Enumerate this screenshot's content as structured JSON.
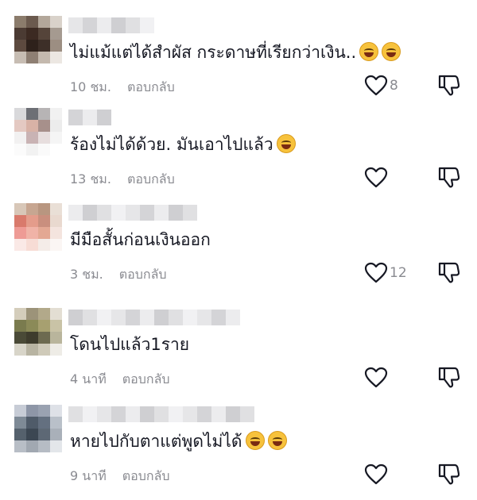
{
  "comments": [
    {
      "text": "ไม่แม้แต่ได้สำผัส กระดาษที่เรียกว่าเงิน..",
      "emojis": 2,
      "time": "10 ชม.",
      "reply": "ตอบกลับ",
      "likes": "8",
      "avatar": [
        "#8b7c6c",
        "#6b5a4e",
        "#b3a79a",
        "#d9d2ca",
        "#4b3b33",
        "#3c2a22",
        "#55443a",
        "#a59a90",
        "#5d4a3f",
        "#2e211b",
        "#3d2f28",
        "#9c8e82",
        "#c7bdb3",
        "#8e7f73",
        "#c4b9ae",
        "#ece7e2"
      ],
      "name_w": 6
    },
    {
      "text": "ร้องไม่ได้ด้วย. มันเอาไปแล้ว",
      "emojis": 1,
      "time": "13 ชม.",
      "reply": "ตอบกลับ",
      "likes": "",
      "avatar": [
        "#d9d9db",
        "#6d6f75",
        "#b7b4b5",
        "#f1f1f1",
        "#e4c9c2",
        "#d8b2a6",
        "#a7908b",
        "#ececec",
        "#f2f1f1",
        "#c9b3b4",
        "#e7dede",
        "#f5f5f5",
        "#fbfbfb",
        "#f2f2f2",
        "#fafafa",
        "#ffffff"
      ],
      "name_w": 3
    },
    {
      "text": "มีมือสั้นก่อนเงินออก",
      "emojis": 0,
      "time": "3 ชม.",
      "reply": "ตอบกลับ",
      "likes": "12",
      "avatar": [
        "#d8c7b8",
        "#c7a691",
        "#b89680",
        "#e9dfd6",
        "#d97a6c",
        "#e49c8b",
        "#c98f7e",
        "#e9d9cf",
        "#ee9b95",
        "#f0b3a7",
        "#e3a893",
        "#f4e4de",
        "#fae9e6",
        "#f7dcd5",
        "#f4ece8",
        "#fbf6f4"
      ],
      "name_w": 9
    },
    {
      "text": "โดนไปแล้ว1ราย",
      "emojis": 0,
      "time": "4 นาที",
      "reply": "ตอบกลับ",
      "likes": "",
      "avatar": [
        "#d4cdbb",
        "#9c9379",
        "#b2a98a",
        "#e3ded3",
        "#7a7b4e",
        "#8b8a58",
        "#a7a070",
        "#c9c3a6",
        "#4a4a37",
        "#3e3c2d",
        "#6d6a50",
        "#b9b59c",
        "#d8d5c9",
        "#b8b4a2",
        "#cfcab9",
        "#eeece6"
      ],
      "name_w": 12
    },
    {
      "text": "หายไปกับตาแต่พูดไม่ได้",
      "emojis": 2,
      "time": "9 นาที",
      "reply": "ตอบกลับ",
      "likes": "",
      "avatar": [
        "#c7ccd6",
        "#8e96a7",
        "#9aa2b1",
        "#dee1e7",
        "#7e8a96",
        "#4f5b69",
        "#647080",
        "#b9c0c9",
        "#55616d",
        "#3c4753",
        "#5d6875",
        "#a9b0b9",
        "#b8bec6",
        "#a1a8b1",
        "#b6bcc4",
        "#e3e6ea"
      ],
      "name_w": 13
    }
  ],
  "icons": {
    "like": "heart-outline-icon",
    "dislike": "thumbs-down-outline-icon"
  },
  "colors": {
    "meta": "#8a8b91",
    "text": "#161823"
  }
}
